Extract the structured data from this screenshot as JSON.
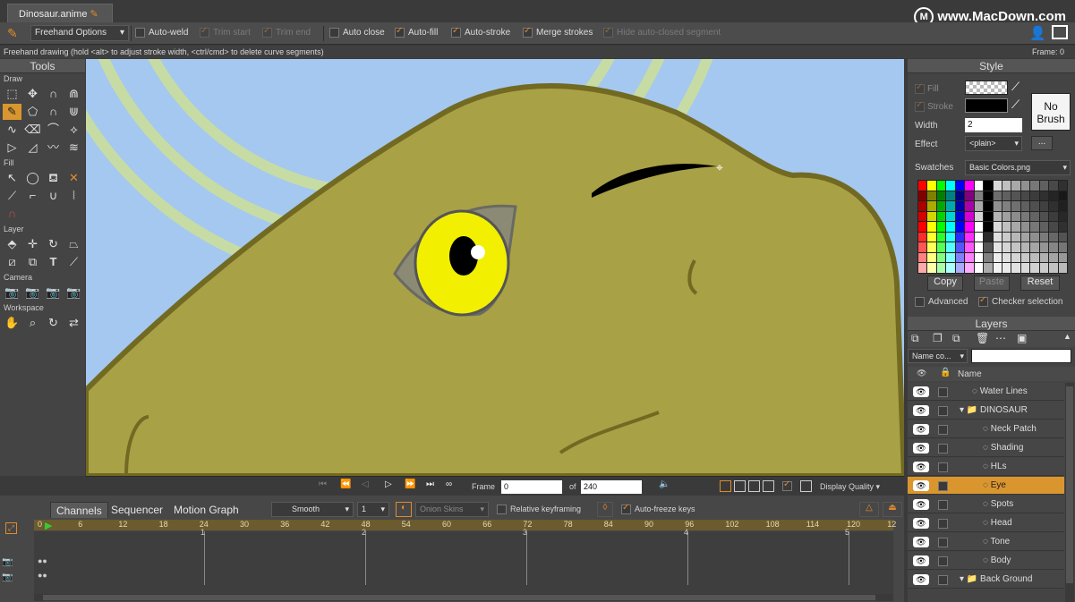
{
  "doc_tab": {
    "title": "Dinosaur.anime"
  },
  "watermark": "www.MacDown.com",
  "options_bar": {
    "tool_dropdown": "Freehand Options",
    "items": [
      {
        "label": "Auto-weld",
        "checked": false,
        "disabled": false
      },
      {
        "label": "Trim start",
        "checked": true,
        "disabled": true
      },
      {
        "label": "Trim end",
        "checked": true,
        "disabled": true
      },
      {
        "label": "Auto close",
        "checked": false,
        "disabled": false
      },
      {
        "label": "Auto-fill",
        "checked": true,
        "disabled": false
      },
      {
        "label": "Auto-stroke",
        "checked": true,
        "disabled": false
      },
      {
        "label": "Merge strokes",
        "checked": true,
        "disabled": false
      },
      {
        "label": "Hide auto-closed segment",
        "checked": true,
        "disabled": true
      }
    ]
  },
  "status": {
    "hint": "Freehand drawing (hold <alt> to adjust stroke width, <ctrl/cmd> to delete curve segments)",
    "frame": "Frame: 0"
  },
  "tools": {
    "title": "Tools",
    "sections": {
      "draw": "Draw",
      "fill": "Fill",
      "layer": "Layer",
      "camera": "Camera",
      "workspace": "Workspace"
    }
  },
  "style": {
    "title": "Style",
    "fill_label": "Fill",
    "stroke_label": "Stroke",
    "width_label": "Width",
    "width_value": "2",
    "effect_label": "Effect",
    "effect_value": "<plain>",
    "effect_more": "...",
    "no_brush": "No Brush",
    "swatches_label": "Swatches",
    "swatches_value": "Basic Colors.png",
    "copy": "Copy",
    "paste": "Paste",
    "reset": "Reset",
    "advanced": "Advanced",
    "checker": "Checker selection",
    "colors": [
      "#ff0000",
      "#ffff00",
      "#00ff00",
      "#00ffff",
      "#0000ff",
      "#ff00ff",
      "#ffffff",
      "#000000",
      "#d8d8d8",
      "#c0c0c0",
      "#a8a8a8",
      "#909090",
      "#787878",
      "#606060",
      "#484848",
      "#303030"
    ]
  },
  "layers": {
    "title": "Layers",
    "name_dropdown": "Name co...",
    "header_name": "Name",
    "rows": [
      {
        "name": "Water Lines",
        "indent": 0,
        "folder": false,
        "selected": false
      },
      {
        "name": "DINOSAUR",
        "indent": 0,
        "folder": true,
        "selected": false
      },
      {
        "name": "Neck Patch",
        "indent": 1,
        "folder": false,
        "selected": false
      },
      {
        "name": "Shading",
        "indent": 1,
        "folder": false,
        "selected": false
      },
      {
        "name": "HLs",
        "indent": 1,
        "folder": false,
        "selected": false
      },
      {
        "name": "Eye",
        "indent": 1,
        "folder": false,
        "selected": true
      },
      {
        "name": "Spots",
        "indent": 1,
        "folder": false,
        "selected": false
      },
      {
        "name": "Head",
        "indent": 1,
        "folder": false,
        "selected": false
      },
      {
        "name": "Tone",
        "indent": 1,
        "folder": false,
        "selected": false
      },
      {
        "name": "Body",
        "indent": 1,
        "folder": false,
        "selected": false
      },
      {
        "name": "Back Ground",
        "indent": 0,
        "folder": true,
        "selected": false
      }
    ]
  },
  "playback": {
    "frame_label": "Frame",
    "frame_value": "0",
    "of_label": "of",
    "total_value": "240",
    "display_quality": "Display Quality"
  },
  "timeline": {
    "tabs": [
      "Channels",
      "Sequencer",
      "Motion Graph"
    ],
    "interp": "Smooth",
    "step": "1",
    "onion": "Onion Skins",
    "relative": "Relative keyframing",
    "autofreeze": "Auto-freeze keys",
    "ruler_ticks": [
      "0",
      "6",
      "12",
      "18",
      "24",
      "30",
      "36",
      "42",
      "48",
      "54",
      "60",
      "66",
      "72",
      "78",
      "84",
      "90",
      "96",
      "102",
      "108",
      "114",
      "120",
      "12"
    ],
    "track_marks": [
      "1",
      "2",
      "3",
      "4",
      "5"
    ]
  }
}
